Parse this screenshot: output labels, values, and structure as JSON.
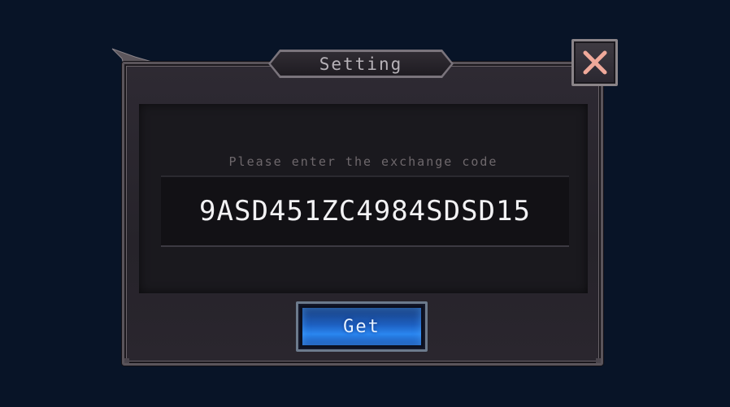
{
  "dialog": {
    "title": "Setting",
    "prompt": "Please enter the exchange code",
    "code_value": "9ASD451ZC4984SDSD15",
    "get_label": "Get"
  },
  "icons": {
    "close": "close-x-icon",
    "wing": "wing-ornament-icon"
  },
  "colors": {
    "background": "#081427",
    "frame": "#5a545a",
    "button_blue": "#2a86f0",
    "close_x": "#f0a99a"
  }
}
